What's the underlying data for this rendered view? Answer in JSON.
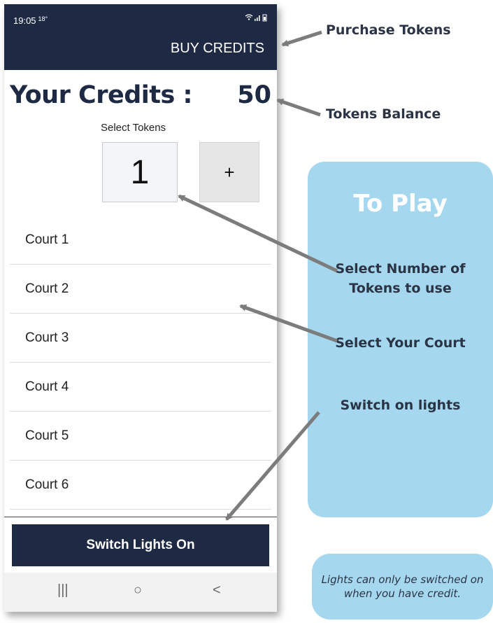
{
  "status_bar": {
    "time": "19:05",
    "temperature": "18°",
    "icons": "wifi signal battery"
  },
  "app_bar": {
    "buy_credits": "BUY CREDITS"
  },
  "credits": {
    "label": "Your Credits :",
    "value": "50"
  },
  "token_selector": {
    "label": "Select Tokens",
    "value": "1",
    "increment": "+"
  },
  "courts": [
    "Court 1",
    "Court 2",
    "Court 3",
    "Court 4",
    "Court 5",
    "Court 6"
  ],
  "switch_lights_button": "Switch Lights On",
  "nav_bar": {
    "recents": "|||",
    "home": "○",
    "back": "<"
  },
  "annotations": {
    "purchase_tokens": "Purchase Tokens",
    "tokens_balance": "Tokens Balance",
    "panel_title": "To Play",
    "select_tokens_line1": "Select Number of",
    "select_tokens_line2": "Tokens to use",
    "select_court": "Select Your Court",
    "switch_lights": "Switch on lights",
    "note": "Lights can only be switched on when you have credit."
  },
  "colors": {
    "navy": "#1e2a44",
    "panel_blue": "#a5d7ef",
    "annotation_text": "#2b3445"
  }
}
